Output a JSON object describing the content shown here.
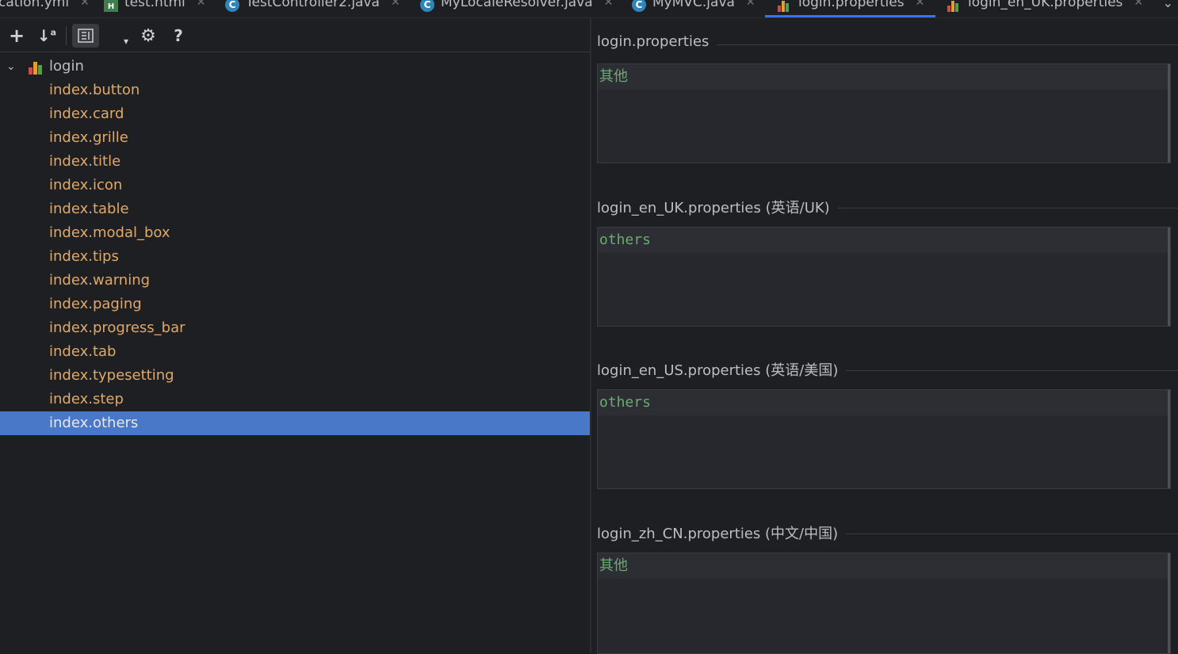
{
  "tabs": [
    {
      "label": "cation.yml",
      "icon": "yaml-file-icon"
    },
    {
      "label": "test.html",
      "icon": "html-file-icon"
    },
    {
      "label": "TestController2.java",
      "icon": "java-class-icon"
    },
    {
      "label": "MyLocaleResolver.java",
      "icon": "java-class-icon"
    },
    {
      "label": "MyMVC.java",
      "icon": "java-class-icon"
    },
    {
      "label": "login.properties",
      "icon": "properties-file-icon",
      "active": true
    },
    {
      "label": "login_en_UK.properties",
      "icon": "properties-file-icon"
    }
  ],
  "toolbar": {
    "add": "+",
    "sort": "↓",
    "sort_sup": "a",
    "help": "?"
  },
  "tree": {
    "root": "login",
    "keys": [
      "index.button",
      "index.card",
      "index.grille",
      "index.title",
      "index.icon",
      "index.table",
      "index.modal_box",
      "index.tips",
      "index.warning",
      "index.paging",
      "index.progress_bar",
      "index.tab",
      "index.typesetting",
      "index.step",
      "index.others"
    ],
    "selected_index": 14
  },
  "sections": [
    {
      "title": "login.properties",
      "value": "其他"
    },
    {
      "title": "login_en_UK.properties (英语/UK)",
      "value": "others"
    },
    {
      "title": "login_en_US.properties (英语/美国)",
      "value": "others"
    },
    {
      "title": "login_zh_CN.properties (中文/中国)",
      "value": "其他"
    }
  ],
  "colors": {
    "accent": "#3574f0",
    "selection": "#4a78c9",
    "key_text": "#e0a869",
    "value_text": "#6aab73"
  }
}
